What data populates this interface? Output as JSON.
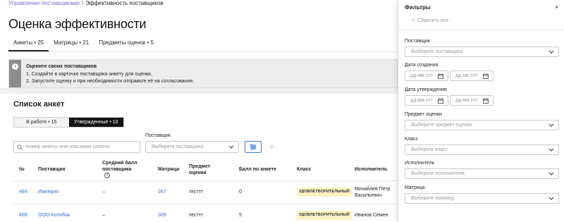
{
  "breadcrumb": {
    "parent": "Управление поставщиками",
    "separator": "/",
    "current": "Эффективность поставщиков"
  },
  "page": {
    "title": "Оценка эффективности"
  },
  "tabs": [
    {
      "label": "Анкеты • 25",
      "active": true
    },
    {
      "label": "Матрицы • 21",
      "active": false
    },
    {
      "label": "Предметы оценок • 5",
      "active": false
    }
  ],
  "banner": {
    "icon": "info-icon",
    "title": "Оцените своих поставщиков",
    "line1": "1. Создайте в карточке поставщика анкету для оценки.",
    "line2": "2. Запустите оценку и при необходимости отправьте её на согласование."
  },
  "list": {
    "title": "Список анкет",
    "segments": [
      {
        "label": "В работе • 15",
        "active": false
      },
      {
        "label": "Утвержденные • 10",
        "active": true
      }
    ],
    "search_placeholder": "Номер анкеты или описанию работы",
    "supplier_label": "Поставщик",
    "supplier_placeholder": "Выберите поставщика",
    "clear_label": "×"
  },
  "table": {
    "headers": {
      "num": "№",
      "supplier": "Поставщик",
      "avg": "Средний балл поставщика",
      "matrix": "Матрица",
      "subject": "Предмет оценки",
      "score": "Балл по анкете",
      "class": "Класс",
      "executor": "Исполнитель"
    },
    "rows": [
      {
        "num": "484",
        "supplier": "Империя",
        "avg": "–",
        "matrix": "267",
        "subject": "тесттт",
        "score": "0",
        "class": "УДОВЛЕТВОРИТЕЛЬНЫЙ",
        "executor": "Михайлев Петр Васильевич"
      },
      {
        "num": "469",
        "supplier": "ООО Колобок",
        "avg": "–",
        "matrix": "309",
        "subject": "тесттт",
        "score": "5",
        "class": "УДОВЛЕТВОРИТЕЛЬНЫЙ",
        "executor": "Иванов Семен"
      }
    ]
  },
  "filters": {
    "title": "Фильтры",
    "close_label": "×",
    "reset_label": "Сбросить все",
    "supplier": {
      "label": "Поставщик",
      "placeholder": "Выберите поставщика"
    },
    "created": {
      "label": "Дата создания",
      "from": "дд.мм.гггг",
      "to": "дд.мм.гггг"
    },
    "approved": {
      "label": "Дата утверждения",
      "from": "дд.мм.гггг",
      "to": "дд.мм.гггг"
    },
    "subject": {
      "label": "Предмет оценки",
      "placeholder": "Выберите предмет оценки"
    },
    "class": {
      "label": "Класс",
      "placeholder": "Выберите класс"
    },
    "executor": {
      "label": "Исполнитель",
      "placeholder": "Выберите исполнителя"
    },
    "matrix": {
      "label": "Матрица",
      "placeholder": "Выберите матрицу"
    }
  },
  "colors": {
    "accent": "#2b6fd6",
    "breadcrumb_link": "#7d6ad0",
    "badge_bg": "#fbf1c4",
    "dark_segment": "#141414"
  }
}
